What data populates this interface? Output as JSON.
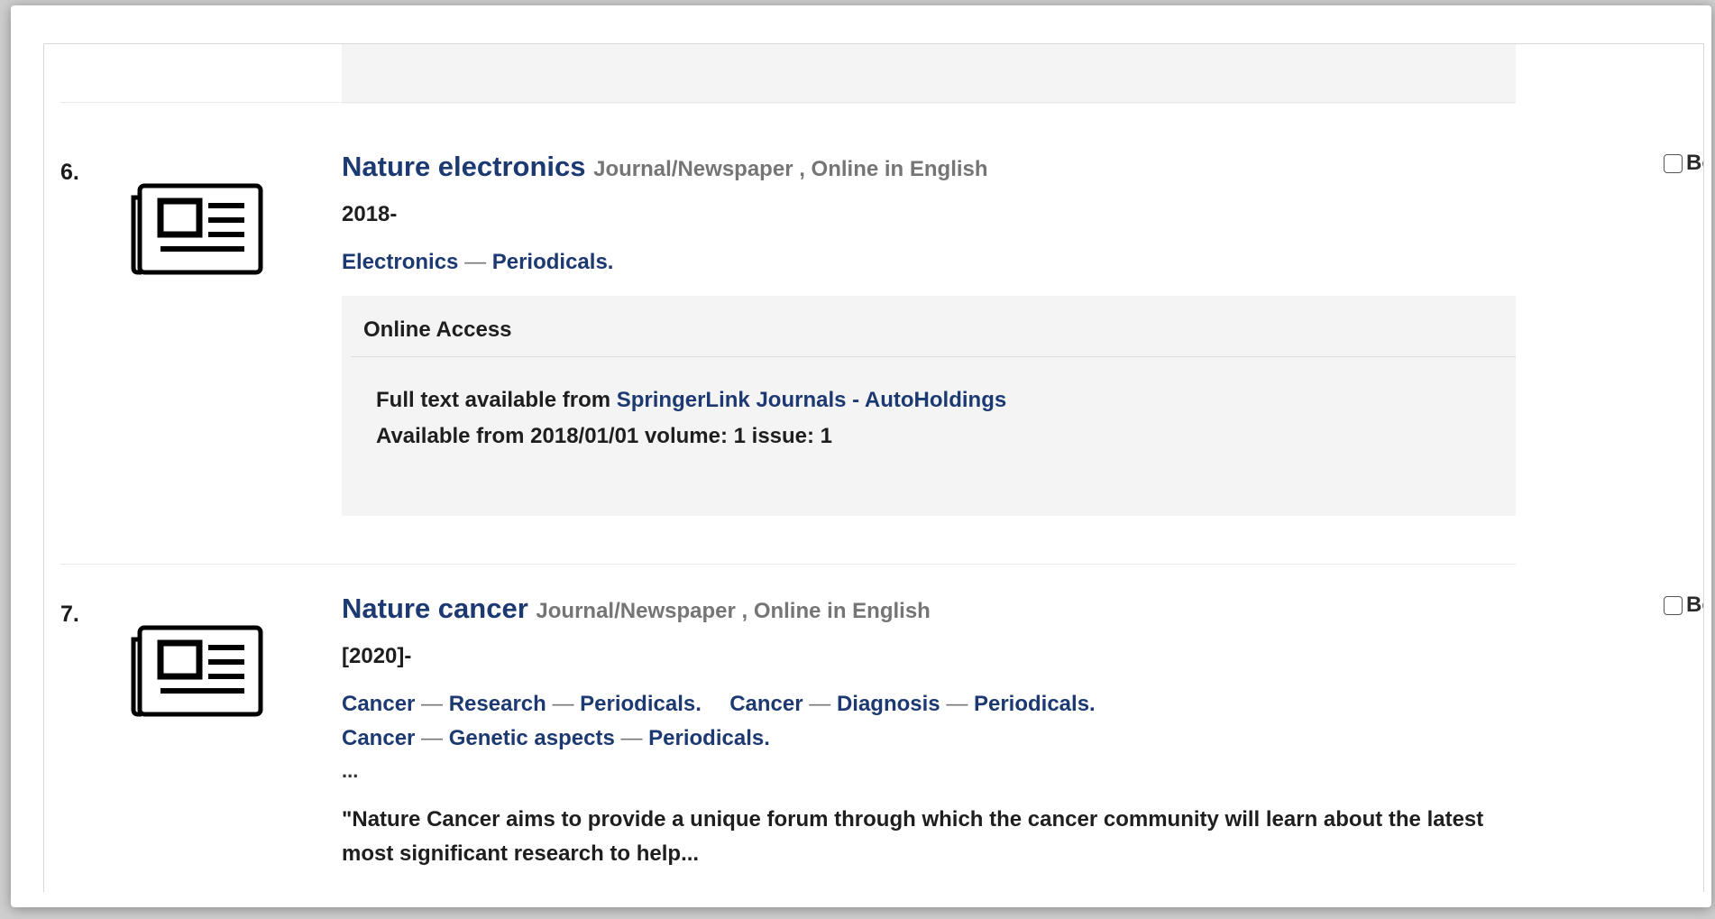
{
  "results": [
    {
      "number": "6.",
      "icon": "newspaper-icon",
      "title": "Nature electronics",
      "format": "Journal/Newspaper , Online in English",
      "bookmark_label": "Bookmark",
      "pub_date": "2018-",
      "subjects": [
        "Electronics",
        "Periodicals."
      ],
      "online_access": {
        "heading": "Online Access",
        "prefix": "Full text available from ",
        "link": "SpringerLink Journals - AutoHoldings",
        "availability": "Available from 2018/01/01 volume: 1 issue: 1"
      }
    },
    {
      "number": "7.",
      "icon": "newspaper-icon",
      "title": "Nature cancer",
      "format": "Journal/Newspaper , Online in English",
      "bookmark_label": "Bookmark",
      "pub_date": "[2020]-",
      "subject_groups": [
        [
          "Cancer",
          "Research",
          "Periodicals."
        ],
        [
          "Cancer",
          "Diagnosis",
          "Periodicals."
        ],
        [
          "Cancer",
          "Genetic aspects",
          "Periodicals."
        ]
      ],
      "ellipsis": "...",
      "summary": "\"Nature Cancer aims to provide a unique forum through which the cancer community will learn about the latest most significant research to help... "
    }
  ],
  "separator": "—",
  "colors": {
    "link": "#1d3972",
    "format": "#757575",
    "panel": "#f4f4f4"
  }
}
